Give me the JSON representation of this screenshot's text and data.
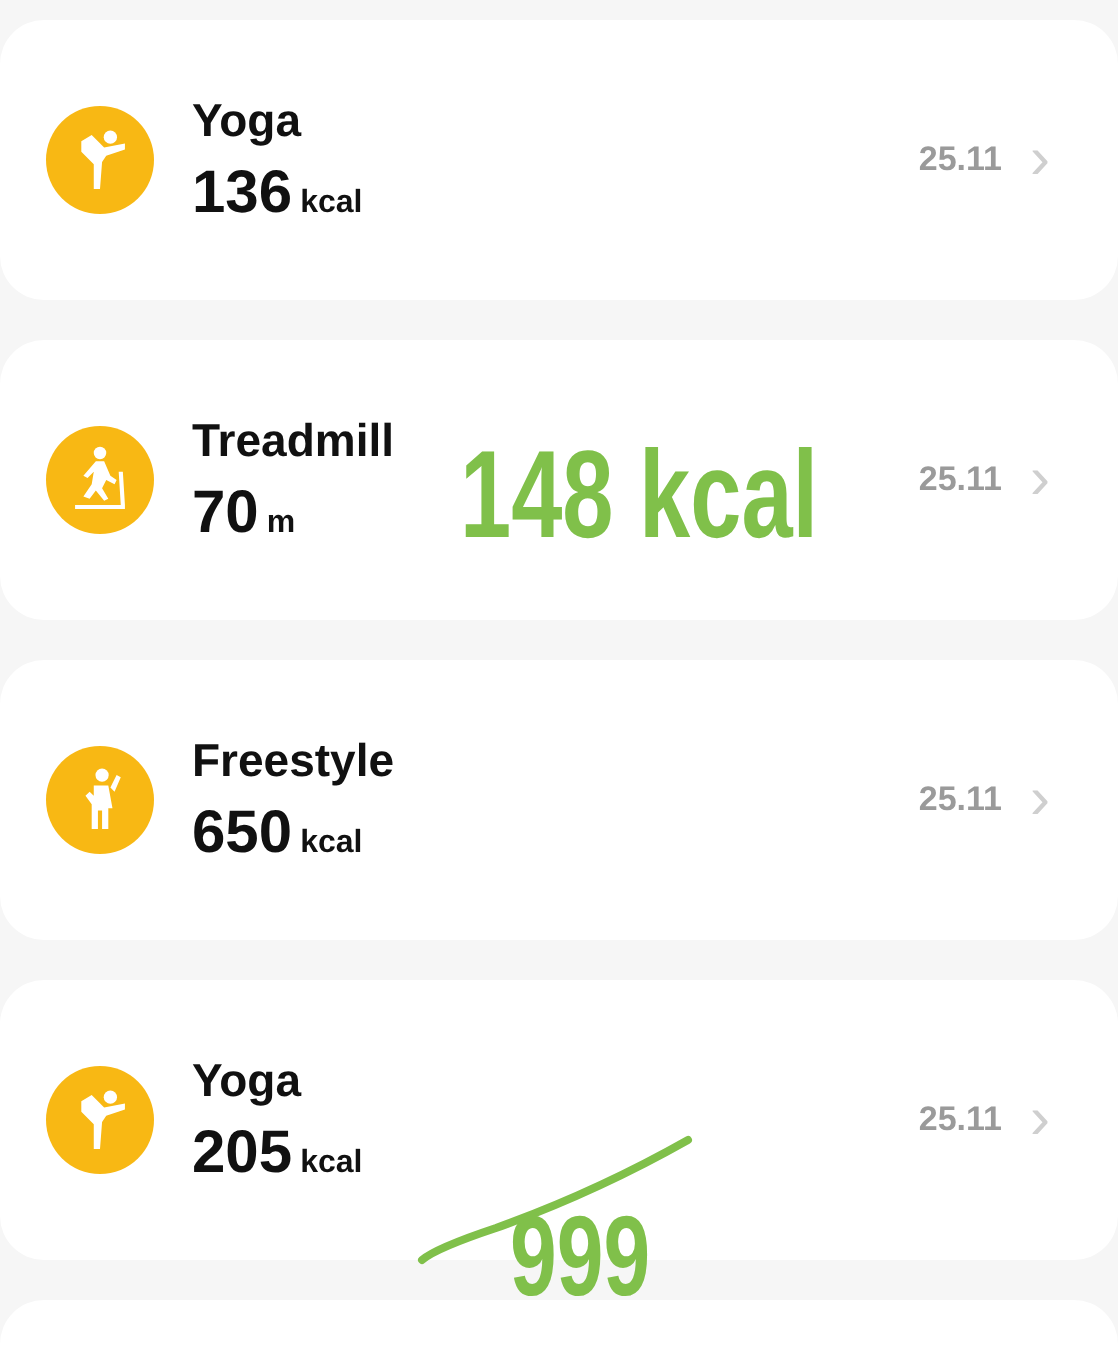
{
  "activities": [
    {
      "kind": "yoga",
      "title": "Yoga",
      "value": "136",
      "unit": "kcal",
      "date": "25.11",
      "chevron": "›"
    },
    {
      "kind": "treadmill",
      "title": "Treadmill",
      "value": "70",
      "unit": "m",
      "date": "25.11",
      "chevron": "›",
      "annotation": {
        "text": "148 kcal",
        "kind": "plain"
      }
    },
    {
      "kind": "freestyle",
      "title": "Freestyle",
      "value": "650",
      "unit": "kcal",
      "date": "25.11",
      "chevron": "›"
    },
    {
      "kind": "yoga",
      "title": "Yoga",
      "value": "205",
      "unit": "kcal",
      "date": "25.11",
      "chevron": "›",
      "annotation": {
        "text": "999",
        "kind": "stroked"
      }
    }
  ]
}
